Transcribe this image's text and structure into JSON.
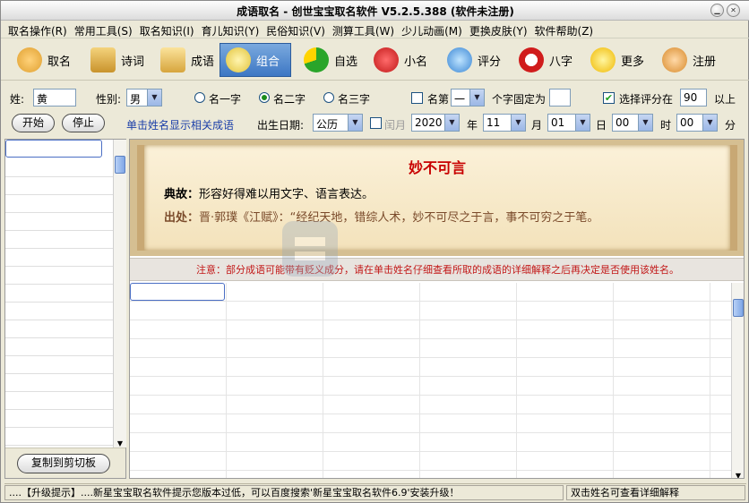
{
  "window": {
    "title": "成语取名 - 创世宝宝取名软件 V5.2.5.388 (软件未注册)"
  },
  "menu": [
    "取名操作(R)",
    "常用工具(S)",
    "取名知识(I)",
    "育儿知识(Y)",
    "民俗知识(V)",
    "测算工具(W)",
    "少儿动画(M)",
    "更换皮肤(Y)",
    "软件帮助(Z)"
  ],
  "toolbar": [
    {
      "label": "取名",
      "icon": "user-group-icon"
    },
    {
      "label": "诗词",
      "icon": "scroll-icon"
    },
    {
      "label": "成语",
      "icon": "book-icon"
    },
    {
      "label": "组合",
      "icon": "triangle-star-icon",
      "active": true
    },
    {
      "label": "自选",
      "icon": "pie-chart-icon"
    },
    {
      "label": "小名",
      "icon": "heart-icon"
    },
    {
      "label": "评分",
      "icon": "magnifier-icon"
    },
    {
      "label": "八字",
      "icon": "clock-icon"
    },
    {
      "label": "更多",
      "icon": "star-plus-icon"
    },
    {
      "label": "注册",
      "icon": "user-lock-icon"
    }
  ],
  "form": {
    "surname_label": "姓:",
    "surname_value": "黄",
    "gender_label": "性别:",
    "gender_value": "男",
    "opt1": "名一字",
    "opt2": "名二字",
    "opt3": "名三字",
    "name_pos_label": "名第",
    "name_pos_value": "一",
    "fixed_char_label": "个字固定为",
    "fixed_char_value": "",
    "score_chk_label": "选择评分在",
    "score_value": "90",
    "score_suffix": "以上",
    "start": "开始",
    "stop": "停止",
    "link": "单击姓名显示相关成语",
    "birth_label": "出生日期:",
    "calendar_value": "公历",
    "leap_label": "闰月",
    "year": "2020",
    "year_unit": "年",
    "month": "11",
    "month_unit": "月",
    "day": "01",
    "day_unit": "日",
    "hour": "00",
    "hour_unit": "时",
    "minute": "00",
    "minute_unit": "分"
  },
  "idiom": {
    "title": "妙不可言",
    "dg_label": "典故：",
    "dg_text": "形容好得难以用文字、语言表达。",
    "cc_label": "出处：",
    "cc_text": "晋·郭璞《江赋》：“经纪天地，错综人术，妙不可尽之于言，事不可穷之于笔。"
  },
  "note": "注意：部分成语可能带有贬义成分，请在单击姓名仔细查看所取的成语的详细解释之后再决定是否使用该姓名。",
  "copy_button": "复制到剪切板",
  "status": {
    "left": "....【升级提示】....新星宝宝取名软件提示您版本过低，可以百度搜索'新星宝宝取名软件6.9'安装升级！",
    "right": "双击姓名可查看详细解释"
  },
  "colors": {
    "accent": "#3d77c4",
    "idiom_title": "#c80000",
    "note": "#c21818",
    "link": "#1a3ea8"
  }
}
